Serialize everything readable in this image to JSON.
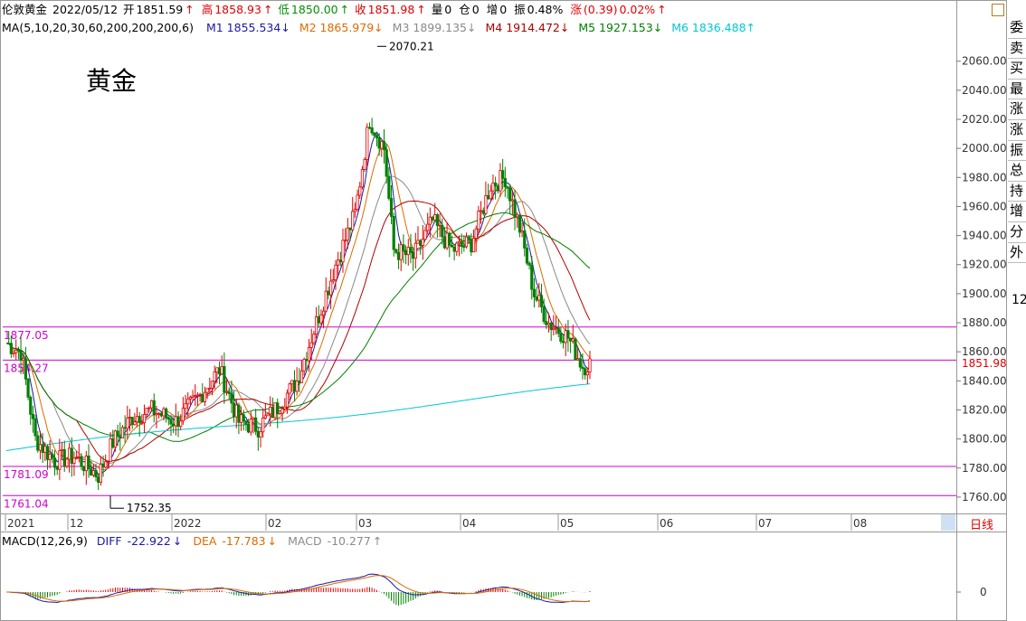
{
  "chart_data": {
    "type": "candlestick",
    "symbol": "伦敦黄金",
    "watermark": "黄金",
    "date": "2022/05/12",
    "quote": {
      "open_label": "开",
      "open": "1851.59",
      "high_label": "高",
      "high": "1858.93",
      "low_label": "低",
      "low": "1850.00",
      "close_label": "收",
      "close": "1851.98",
      "vol_label": "量",
      "vol": "0",
      "oi_label": "仓",
      "oi": "0",
      "add_label": "增",
      "add": "0",
      "amp_label": "振",
      "amp": "0.48%",
      "chg_label": "涨",
      "chg": "(0.39)",
      "chg_pct": "0.02%"
    },
    "ma_header": "MA(5,10,20,30,60,200,200,200,6)",
    "ma": [
      {
        "name": "M1",
        "value": "1855.534",
        "dir": "↓",
        "color": "#1a1aa6"
      },
      {
        "name": "M2",
        "value": "1865.979",
        "dir": "↓",
        "color": "#e06a00"
      },
      {
        "name": "M3",
        "value": "1899.135",
        "dir": "↓",
        "color": "#8a8a8a"
      },
      {
        "name": "M4",
        "value": "1914.472",
        "dir": "↓",
        "color": "#b00000"
      },
      {
        "name": "M5",
        "value": "1927.153",
        "dir": "↓",
        "color": "#008000"
      },
      {
        "name": "M6",
        "value": "1836.488",
        "dir": "↑",
        "color": "#00c8d2"
      }
    ],
    "y_ticks": [
      "2060.00",
      "2040.00",
      "2020.00",
      "2000.00",
      "1980.00",
      "1960.00",
      "1940.00",
      "1920.00",
      "1900.00",
      "1880.00",
      "1860.00",
      "1840.00",
      "1820.00",
      "1800.00",
      "1780.00",
      "1760.00"
    ],
    "y_range": [
      1750,
      2076
    ],
    "current_price_label": "1851.98",
    "high_annotation": "2070.21",
    "low_annotation": "1752.35",
    "hlines": [
      {
        "label": "1877.05",
        "value": 1877.05
      },
      {
        "label": "1854.27",
        "value": 1854.27
      },
      {
        "label": "1781.09",
        "value": 1781.09
      },
      {
        "label": "1761.04",
        "value": 1761.04
      }
    ],
    "x_labels": [
      "2021",
      "12",
      "2022",
      "02",
      "03",
      "04",
      "05",
      "06",
      "07",
      "08"
    ],
    "period_label": "日线",
    "macd": {
      "header": "MACD(12,26,9)",
      "diff_label": "DIFF",
      "diff": "-22.922",
      "diff_dir": "↓",
      "dea_label": "DEA",
      "dea": "-17.783",
      "dea_dir": "↓",
      "macd_label": "MACD",
      "macd": "-10.277",
      "macd_dir": "↑",
      "zero_label": "0"
    },
    "colors": {
      "up": "#e00000",
      "down": "#008000",
      "hline": "#d000d0",
      "text_red": "#e00000",
      "text_green": "#009000"
    }
  },
  "side_panel": {
    "items": [
      "委",
      "卖",
      "买",
      "最",
      "涨",
      "涨",
      "振",
      "总",
      "持",
      "增",
      "分",
      "外"
    ],
    "value": "12"
  }
}
